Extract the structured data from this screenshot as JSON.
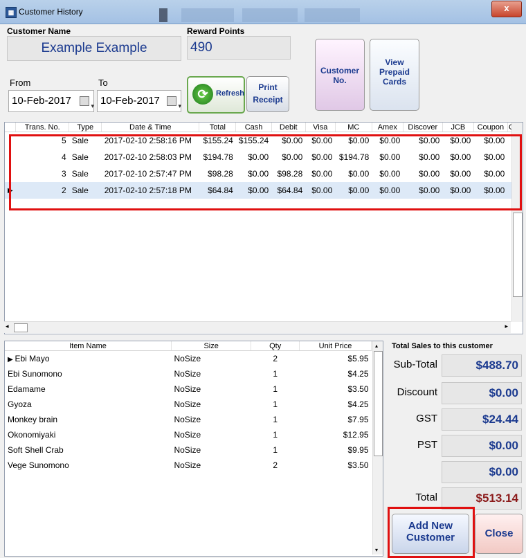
{
  "window": {
    "title": "Customer History",
    "close_label": "x"
  },
  "customer": {
    "name_label": "Customer Name",
    "name_value": "Example Example",
    "points_label": "Reward Points",
    "points_value": "490"
  },
  "dates": {
    "from_label": "From",
    "from_value": "10-Feb-2017",
    "to_label": "To",
    "to_value": "10-Feb-2017"
  },
  "buttons": {
    "refresh": "Refresh",
    "print_line1": "Print",
    "print_line2": "Receipt",
    "customer_no_line1": "Customer",
    "customer_no_line2": "No.",
    "prepaid_line1": "View",
    "prepaid_line2": "Prepaid",
    "prepaid_line3": "Cards",
    "add_line1": "Add New",
    "add_line2": "Customer",
    "close": "Close"
  },
  "transactions": {
    "columns": [
      "Trans. No.",
      "Type",
      "Date & Time",
      "Total",
      "Cash",
      "Debit",
      "Visa",
      "MC",
      "Amex",
      "Discover",
      "JCB",
      "Coupon",
      "C"
    ],
    "rows": [
      [
        "5",
        "Sale",
        "2017-02-10 2:58:16 PM",
        "$155.24",
        "$155.24",
        "$0.00",
        "$0.00",
        "$0.00",
        "$0.00",
        "$0.00",
        "$0.00",
        "$0.00"
      ],
      [
        "4",
        "Sale",
        "2017-02-10 2:58:03 PM",
        "$194.78",
        "$0.00",
        "$0.00",
        "$0.00",
        "$194.78",
        "$0.00",
        "$0.00",
        "$0.00",
        "$0.00"
      ],
      [
        "3",
        "Sale",
        "2017-02-10 2:57:47 PM",
        "$98.28",
        "$0.00",
        "$98.28",
        "$0.00",
        "$0.00",
        "$0.00",
        "$0.00",
        "$0.00",
        "$0.00"
      ],
      [
        "2",
        "Sale",
        "2017-02-10 2:57:18 PM",
        "$64.84",
        "$0.00",
        "$64.84",
        "$0.00",
        "$0.00",
        "$0.00",
        "$0.00",
        "$0.00",
        "$0.00"
      ]
    ]
  },
  "items": {
    "columns": [
      "Item Name",
      "Size",
      "Qty",
      "Unit Price"
    ],
    "rows": [
      [
        "Ebi Mayo",
        "NoSize",
        "2",
        "$5.95"
      ],
      [
        "Ebi Sunomono",
        "NoSize",
        "1",
        "$4.25"
      ],
      [
        "Edamame",
        "NoSize",
        "1",
        "$3.50"
      ],
      [
        "Gyoza",
        "NoSize",
        "1",
        "$4.25"
      ],
      [
        "Monkey brain",
        "NoSize",
        "1",
        "$7.95"
      ],
      [
        "Okonomiyaki",
        "NoSize",
        "1",
        "$12.95"
      ],
      [
        "Soft Shell Crab",
        "NoSize",
        "1",
        "$9.95"
      ],
      [
        "Vege Sunomono",
        "NoSize",
        "2",
        "$3.50"
      ]
    ]
  },
  "summary": {
    "heading": "Total Sales to this customer",
    "subtotal_label": "Sub-Total",
    "subtotal_value": "$488.70",
    "discount_label": "Discount",
    "discount_value": "$0.00",
    "gst_label": "GST",
    "gst_value": "$24.44",
    "pst_label": "PST",
    "pst_value": "$0.00",
    "extra_label": "",
    "extra_value": "$0.00",
    "total_label": "Total",
    "total_value": "$513.14"
  },
  "colors": {
    "highlight_box": "#e01010",
    "accent_text": "#1b3a8f",
    "total_text": "#8b1a1a"
  }
}
